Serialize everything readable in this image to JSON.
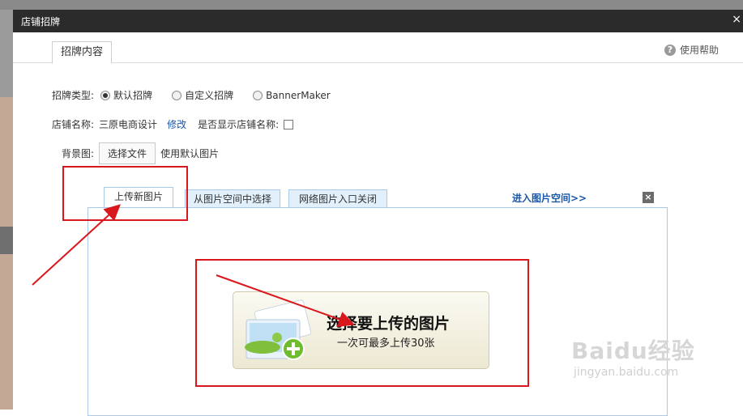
{
  "dialog": {
    "title": "店铺招牌",
    "close": "×"
  },
  "tabs": {
    "main": "招牌内容",
    "help": "使用帮助",
    "help_icon": "?"
  },
  "form": {
    "type_label": "招牌类型:",
    "options": [
      "默认招牌",
      "自定义招牌",
      "BannerMaker"
    ],
    "selected_option": "默认招牌",
    "shop_name_label": "店铺名称:",
    "shop_name": "三原电商设计",
    "edit_link": "修改",
    "show_name_label": "是否显示店铺名称:",
    "show_name_checked": false,
    "bg_label": "背景图:",
    "choose_file": "选择文件",
    "default_image": "使用默认图片"
  },
  "upload": {
    "tabs": [
      "上传新图片",
      "从图片空间中选择",
      "网络图片入口关闭"
    ],
    "active_tab": "上传新图片",
    "enter_space": "进入图片空间>>",
    "close_icon": "×",
    "button_title": "选择要上传的图片",
    "button_sub": "一次可最多上传30张"
  },
  "watermark": {
    "brand": "Baidu经验",
    "url": "jingyan.baidu.com"
  },
  "colors": {
    "annotation_red": "#d9171d",
    "link_blue": "#1b57a6",
    "title_bar": "#2b2b2b"
  }
}
